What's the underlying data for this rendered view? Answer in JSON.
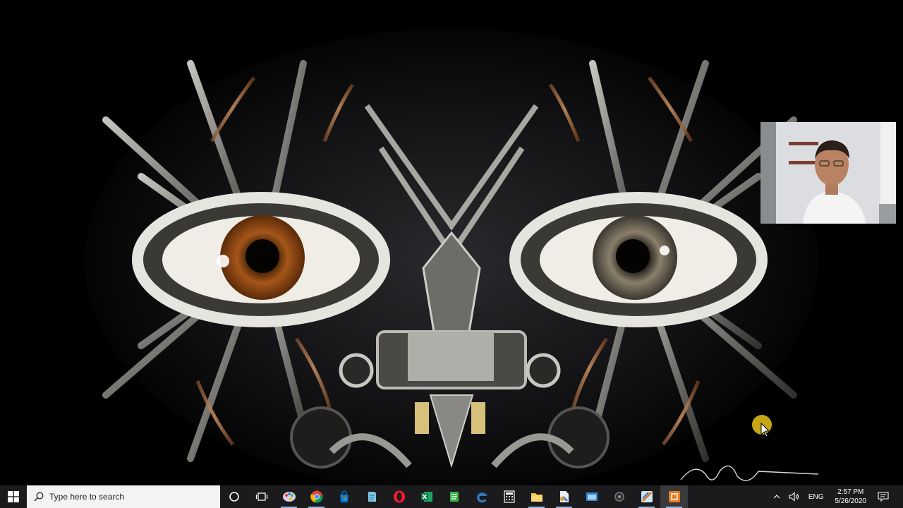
{
  "desktop": {
    "wallpaper": "mechanical-engine-face-with-human-eyes",
    "signature_graphic": "artist-signature"
  },
  "webcam": {
    "description_icon": "presenter-webcam-feed"
  },
  "taskbar": {
    "search_placeholder": "Type here to search",
    "apps": [
      {
        "id": "cortana",
        "icon": "cortana-circle-icon"
      },
      {
        "id": "task-view",
        "icon": "task-view-icon"
      },
      {
        "id": "paint",
        "icon": "paint-palette-icon"
      },
      {
        "id": "chrome",
        "icon": "chrome-icon"
      },
      {
        "id": "store",
        "icon": "store-bag-icon"
      },
      {
        "id": "notepad",
        "icon": "notepad-icon"
      },
      {
        "id": "opera",
        "icon": "opera-icon"
      },
      {
        "id": "excel",
        "icon": "excel-icon"
      },
      {
        "id": "editor",
        "icon": "editor-icon"
      },
      {
        "id": "edge",
        "icon": "edge-icon"
      },
      {
        "id": "calculator",
        "icon": "calculator-icon"
      },
      {
        "id": "explorer",
        "icon": "folder-icon"
      },
      {
        "id": "file-app",
        "icon": "document-app-icon"
      },
      {
        "id": "remote",
        "icon": "window-app-icon"
      },
      {
        "id": "settings-app",
        "icon": "gear-app-icon"
      },
      {
        "id": "tool-app",
        "icon": "tool-app-icon"
      },
      {
        "id": "recorder",
        "icon": "recorder-app-icon"
      }
    ],
    "tray": {
      "chevron": "^",
      "language": "ENG",
      "time": "2:57 PM",
      "date": "5/26/2020"
    }
  },
  "colors": {
    "taskbar": "#1b1b1d",
    "search_box": "#f3f3f3",
    "accent_running": "#8fb4e3",
    "cursor_highlight": "#e8c21a"
  }
}
